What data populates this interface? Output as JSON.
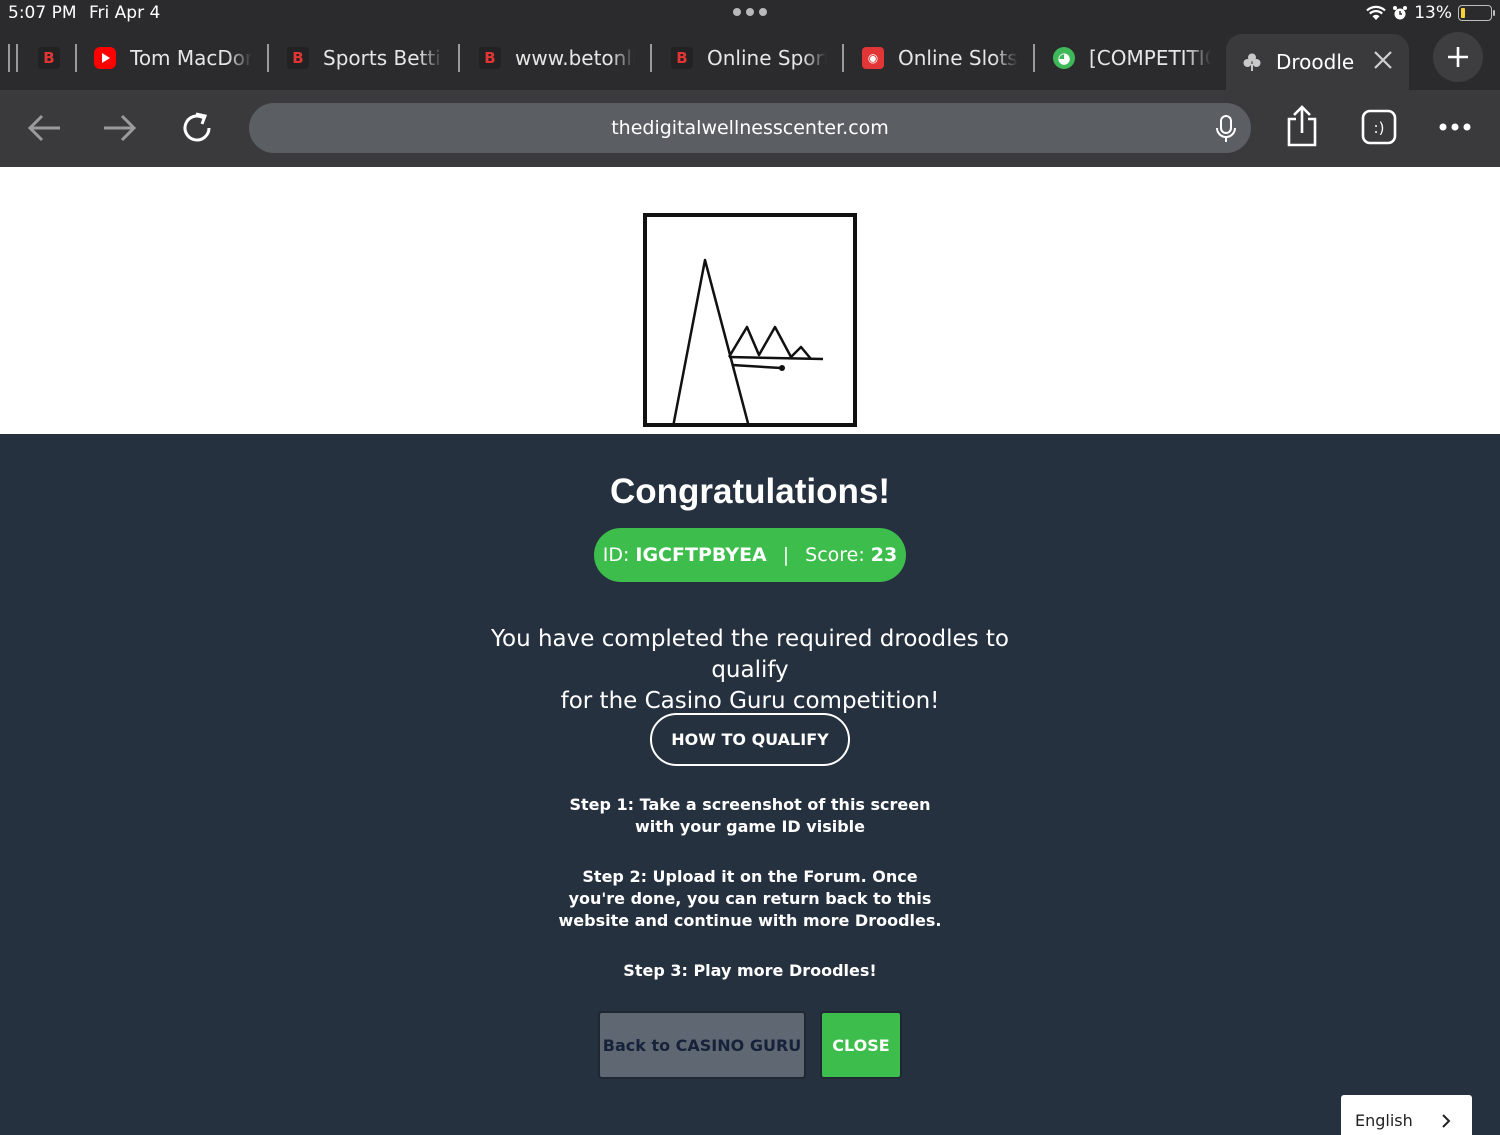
{
  "status_bar": {
    "time": "5:07 PM",
    "date": "Fri Apr 4",
    "battery": "13%",
    "battery_level": 0.13
  },
  "tabs": [
    {
      "label": "",
      "favicon": "b-logo-icon"
    },
    {
      "label": "Tom MacDonald",
      "favicon": "youtube-icon"
    },
    {
      "label": "Sports Betting",
      "favicon": "b-logo-icon"
    },
    {
      "label": "www.betonline",
      "favicon": "b-logo-icon"
    },
    {
      "label": "Online Sports",
      "favicon": "b-logo-icon"
    },
    {
      "label": "Online Slots",
      "favicon": "slots-icon"
    },
    {
      "label": "[COMPETITION",
      "favicon": "globe-icon"
    },
    {
      "label": "Droodle",
      "favicon": "clover-icon",
      "active": true
    }
  ],
  "toolbar": {
    "url": "thedigitalwellnesscenter.com"
  },
  "page": {
    "title": "Congratulations!",
    "id_label": "ID:",
    "id_value": "IGCFTPBYEA",
    "score_label": "Score:",
    "score_value": "23",
    "description_line1": "You have completed the required droodles to qualify",
    "description_line2": "for the Casino Guru competition!",
    "qualify_button": "HOW TO QUALIFY",
    "step1_line1": "Step 1: Take a screenshot of this screen",
    "step1_line2": "with your game ID visible",
    "step2_line1": "Step 2: Upload it on the Forum. Once",
    "step2_line2": "you're done, you can return back to this",
    "step2_line3": "website and continue with more Droodles.",
    "step3": "Step 3: Play more Droodles!",
    "back_button": "Back to CASINO GURU",
    "close_button": "CLOSE",
    "language": "English"
  }
}
